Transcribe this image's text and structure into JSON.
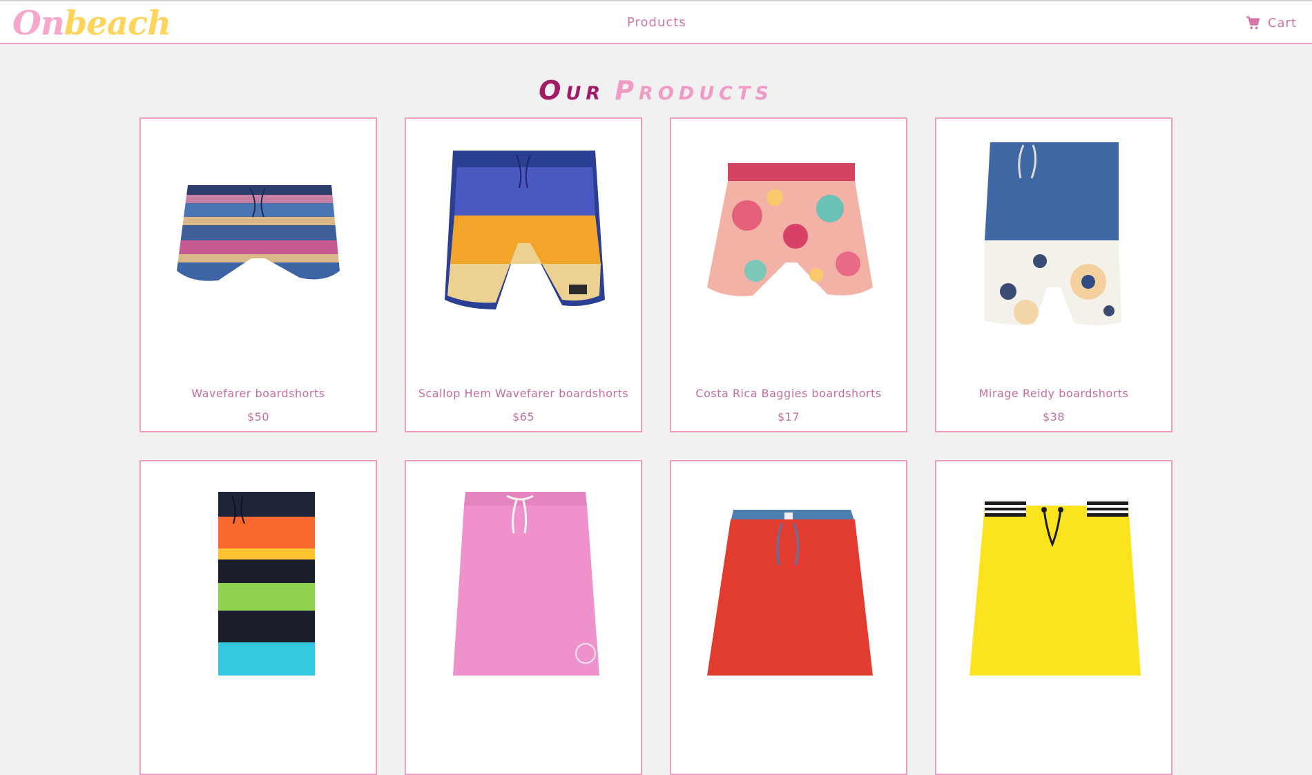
{
  "header": {
    "logo_part1": "On",
    "logo_part2": "beach",
    "nav_products": "Products",
    "nav_cart": "Cart"
  },
  "heading": {
    "word1": "Our",
    "word2": "Products"
  },
  "products": [
    {
      "name": "Wavefarer boardshorts",
      "price": "$50",
      "image": "striped-shorts-image"
    },
    {
      "name": "Scallop Hem Wavefarer boardshorts",
      "price": "$65",
      "image": "blue-yellow-shorts-image"
    },
    {
      "name": "Costa Rica Baggies boardshorts",
      "price": "$17",
      "image": "floral-shorts-image"
    },
    {
      "name": "Mirage Reidy boardshorts",
      "price": "$38",
      "image": "blue-sunflower-shorts-image"
    },
    {
      "name": "",
      "price": "",
      "image": "rainbow-stripe-shorts-image"
    },
    {
      "name": "",
      "price": "",
      "image": "pink-shorts-image"
    },
    {
      "name": "",
      "price": "",
      "image": "red-shorts-image"
    },
    {
      "name": "",
      "price": "",
      "image": "yellow-shorts-image"
    }
  ],
  "colors": {
    "accent": "#ee9cbf",
    "heading_dark": "#a11b66",
    "heading_light": "#f09ac6",
    "text": "#c56e9e"
  }
}
